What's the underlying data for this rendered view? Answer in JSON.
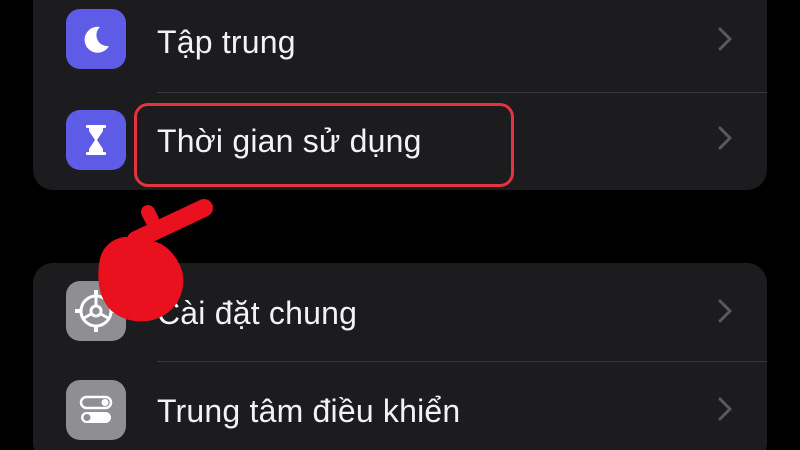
{
  "settings": {
    "focus": {
      "label": "Tập trung",
      "icon": "moon-icon"
    },
    "screen_time": {
      "label": "Thời gian sử dụng",
      "icon": "hourglass-icon"
    },
    "general": {
      "label": "Cài đặt chung",
      "icon": "gear-icon"
    },
    "control_center": {
      "label": "Trung tâm điều khiển",
      "icon": "toggles-icon"
    }
  },
  "colors": {
    "focus_tile": "#5e5ce6",
    "gray_tile": "#8e8e93",
    "highlight": "#e53340",
    "pointer": "#e8111d"
  }
}
